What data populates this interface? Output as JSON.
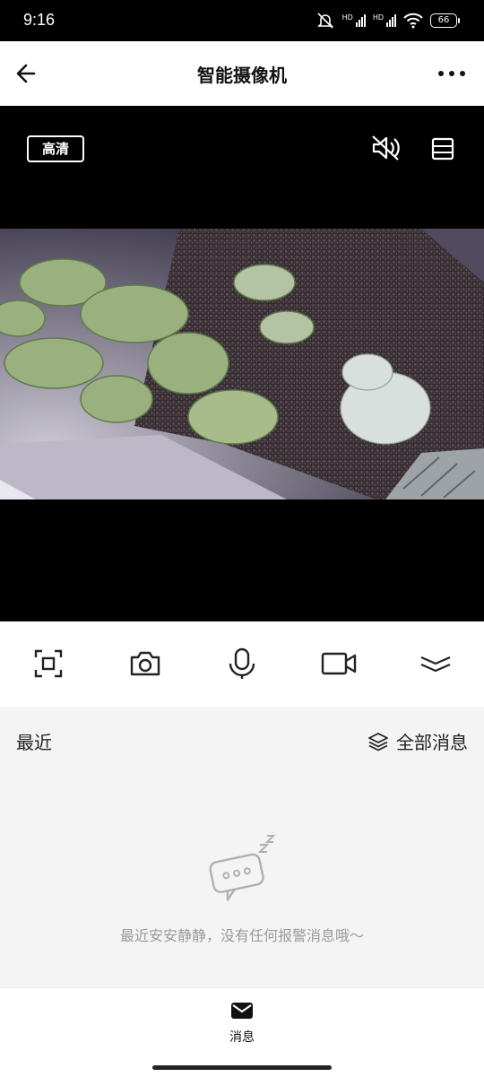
{
  "status_bar": {
    "time": "9:16",
    "battery": "66",
    "net1": "HD",
    "net2": "HD"
  },
  "header": {
    "title": "智能摄像机"
  },
  "video": {
    "quality_label": "高清"
  },
  "controls": [
    {
      "name": "screenshot-frame",
      "icon": "frame-capture-icon"
    },
    {
      "name": "snapshot",
      "icon": "camera-icon"
    },
    {
      "name": "talk",
      "icon": "microphone-icon"
    },
    {
      "name": "record",
      "icon": "video-camera-icon"
    },
    {
      "name": "expand",
      "icon": "chevron-double-down-icon"
    }
  ],
  "messages": {
    "recent_label": "最近",
    "all_label": "全部消息",
    "empty_text": "最近安安静静，没有任何报警消息哦～"
  },
  "bottom_nav": {
    "messages_label": "消息"
  },
  "colors": {
    "video_bg": "#000000",
    "panel_bg": "#f4f4f4",
    "muted_text": "#9a9a9a"
  }
}
